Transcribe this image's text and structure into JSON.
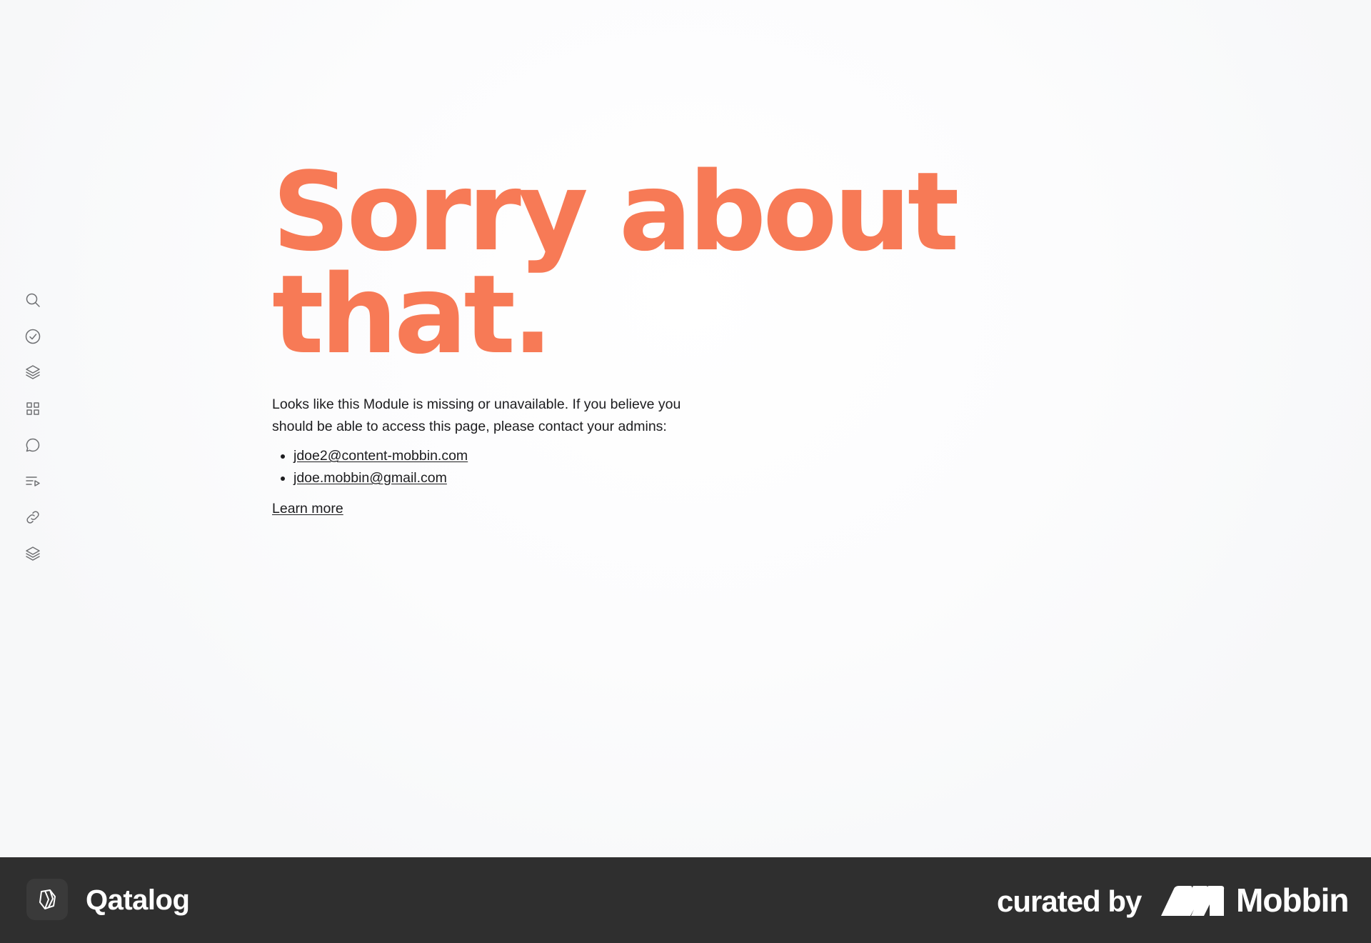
{
  "sidebar": {
    "icons": [
      {
        "name": "search-icon"
      },
      {
        "name": "check-circle-icon"
      },
      {
        "name": "layers-icon"
      },
      {
        "name": "grid-icon"
      },
      {
        "name": "chat-bubble-icon"
      },
      {
        "name": "playlist-icon"
      },
      {
        "name": "link-icon"
      },
      {
        "name": "stack-icon"
      }
    ]
  },
  "error": {
    "headline_line1": "Sorry about",
    "headline_line2": "that.",
    "message": "Looks like this Module is missing or unavailable. If you believe you should be able to access this page, please contact your admins:",
    "contacts": [
      "jdoe2@content-mobbin.com",
      "jdoe.mobbin@gmail.com"
    ],
    "learn_more": "Learn more",
    "accent_color": "#f77a56"
  },
  "footer": {
    "brand_name": "Qatalog",
    "curated_by": "curated by",
    "curator_name": "Mobbin",
    "background": "#2f2f2f"
  }
}
